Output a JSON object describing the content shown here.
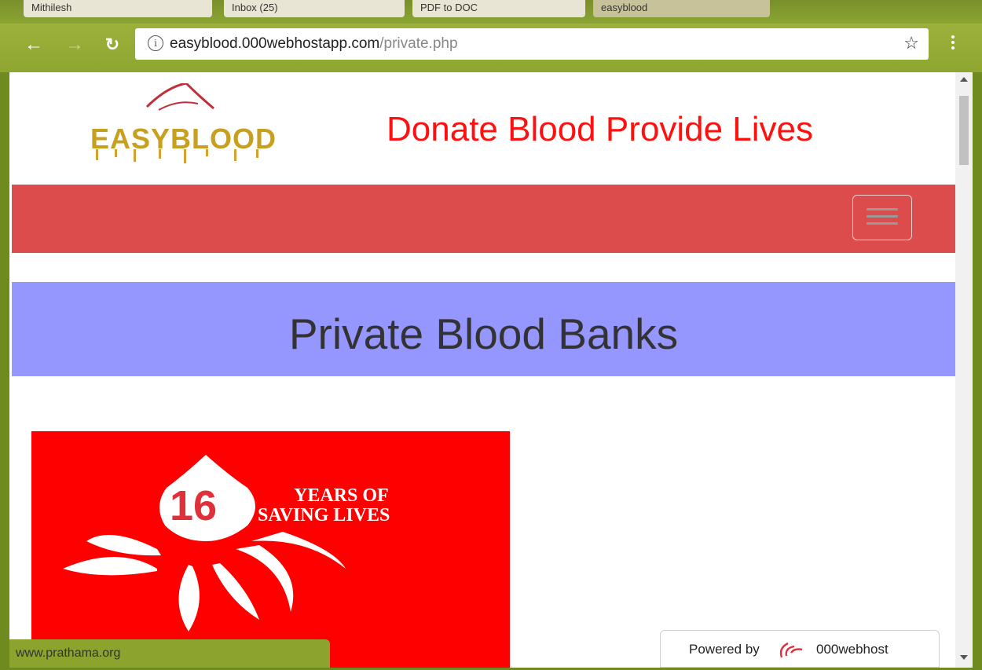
{
  "browser": {
    "tabs": [
      {
        "label": "Mithilesh",
        "active": false
      },
      {
        "label": "Inbox (25)",
        "active": false
      },
      {
        "label": "PDF to DOC",
        "active": false
      },
      {
        "label": "easyblood",
        "active": true
      }
    ],
    "url_host": "easyblood.000webhostapp.com",
    "url_path": "/private.php",
    "icons": {
      "back": "back-arrow-icon",
      "forward": "forward-arrow-icon",
      "reload": "reload-icon",
      "info": "info-icon",
      "bookmark": "star-icon",
      "menu": "kebab-menu-icon"
    }
  },
  "site": {
    "logo_text": "EASYBLOOD",
    "tagline": "Donate Blood Provide Lives",
    "page_title": "Private Blood Banks",
    "promo": {
      "number": "16",
      "line1": "YEARS OF",
      "line2": "SAVING LIVES"
    }
  },
  "status": {
    "link_preview": "www.prathama.org",
    "powered_by_label": "Powered by",
    "powered_by_brand": "000webhost"
  },
  "colors": {
    "tagline": "#ff1010",
    "navbar": "#dc4c4c",
    "banner": "#9696ff",
    "promo": "#ff0000"
  }
}
